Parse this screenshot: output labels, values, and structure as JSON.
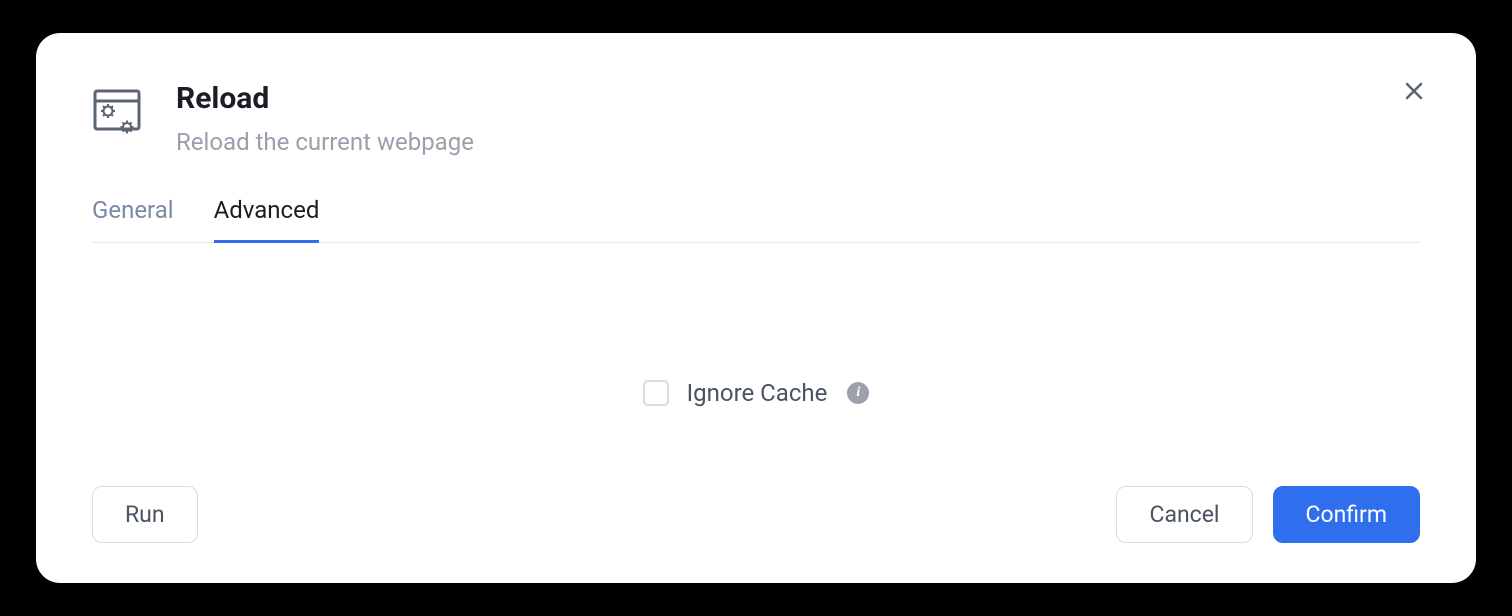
{
  "header": {
    "title": "Reload",
    "subtitle": "Reload the current webpage"
  },
  "tabs": {
    "items": [
      {
        "label": "General",
        "active": false
      },
      {
        "label": "Advanced",
        "active": true
      }
    ]
  },
  "form": {
    "ignore_cache_label": "Ignore Cache",
    "ignore_cache_checked": false
  },
  "footer": {
    "run_label": "Run",
    "cancel_label": "Cancel",
    "confirm_label": "Confirm"
  }
}
